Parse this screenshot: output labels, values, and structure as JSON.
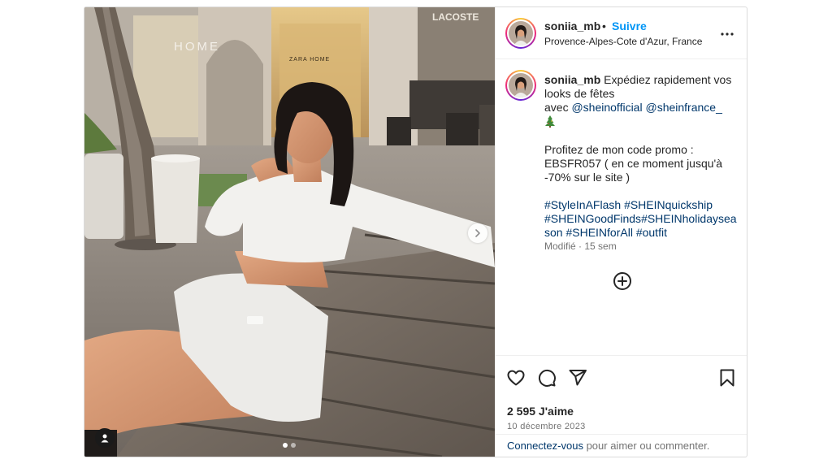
{
  "post": {
    "username": "soniia_mb",
    "separator": "•",
    "follow_label": "Suivre",
    "location": "Provence-Alpes-Cote d'Azur, France",
    "more_icon": "more-horizontal-icon"
  },
  "caption": {
    "username": "soniia_mb",
    "line1": "Expédiez rapidement vos",
    "line2": "looks de fêtes",
    "line3_prefix": "avec ",
    "mention1": "@sheinofficial",
    "mention2": "@sheinfrance_",
    "emoji_icon": "christmas-tree-icon",
    "promo_line1": "Profitez de mon code promo :",
    "promo_line2": "EBSFR057 ( en ce moment jusqu'à",
    "promo_line3": "-70% sur le site )",
    "hashtags_line1": [
      "#StyleInAFlash",
      "#SHEINquickship"
    ],
    "hashtags_line2": [
      "#SHEINGoodFinds",
      "#SHEINholidaysea"
    ],
    "hashtags_line3": [
      "son",
      "#SHEINforAll",
      "#outfit"
    ],
    "modified": "Modifié · 15 sem"
  },
  "actions": {
    "like_icon": "heart-icon",
    "comment_icon": "comment-icon",
    "share_icon": "share-icon",
    "save_icon": "bookmark-icon",
    "likes_text": "2 595 J'aime",
    "date": "10 décembre 2023"
  },
  "footer": {
    "login_link": "Connectez-vous",
    "login_rest": " pour aimer ou commenter."
  },
  "media": {
    "storefront_sign": "LACOSTE",
    "store_sign_left": "HOME",
    "store_sign_center": "ZARA HOME",
    "carousel_total": 2,
    "carousel_active": 1
  },
  "colors": {
    "follow": "#0095f6",
    "link": "#00376b",
    "muted": "#737373",
    "border": "#dbdbdb"
  }
}
